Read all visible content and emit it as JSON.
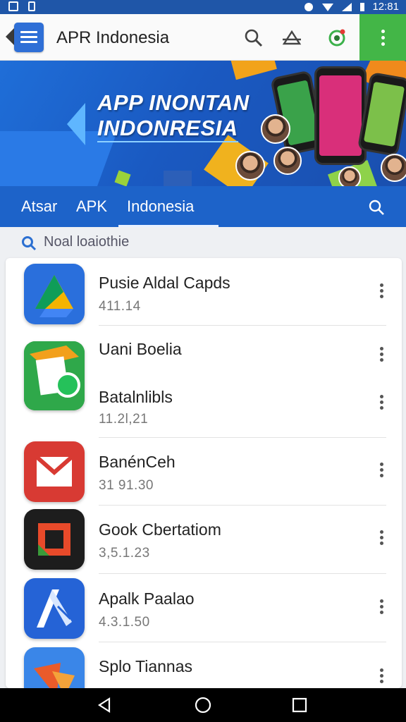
{
  "status_bar": {
    "time": "12:81"
  },
  "app_bar": {
    "title": "APR Indonesia"
  },
  "banner": {
    "title_line1": "APP INONTAN",
    "title_line2": "INDONRESIA"
  },
  "tabs": [
    {
      "label": "Atsar"
    },
    {
      "label": "APK"
    },
    {
      "label": "Indonesia",
      "selected": true
    }
  ],
  "search": {
    "placeholder": "Noal loaiothie"
  },
  "apps": [
    {
      "name": "Pusie Aldal Capds",
      "version": "411.14",
      "icon": "drive-triangle-icon"
    },
    {
      "name": "Uani Boelia",
      "icon": "whatsapp-frame-icon"
    },
    {
      "name": "Batalnlibls",
      "version": "11.2l,21"
    },
    {
      "name": "BanénCeh",
      "version": "31 91.30",
      "icon": "gmail-envelope-icon"
    },
    {
      "name": "Gook Cbertatiom",
      "version": "3,5.1.23",
      "icon": "square-frame-icon"
    },
    {
      "name": "Apalk Paalao",
      "version": "4.3.1.50",
      "icon": "stylized-a-icon"
    },
    {
      "name": "Splo Tiannas",
      "icon": "orange-shape-icon"
    }
  ],
  "colors": {
    "primary": "#1d63c9",
    "accent_green": "#43b647",
    "banner": "#1a59c1"
  }
}
